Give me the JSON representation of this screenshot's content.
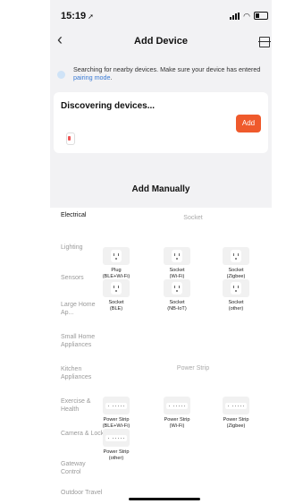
{
  "status": {
    "time": "15:19"
  },
  "nav": {
    "title": "Add Device"
  },
  "searching": {
    "text": "Searching for nearby devices. Make sure your device has entered ",
    "link": "pairing mode",
    "end": "."
  },
  "discover": {
    "title": "Discovering devices...",
    "add_label": "Add"
  },
  "manual": {
    "title": "Add Manually"
  },
  "categories": [
    "Electrical",
    "Lighting",
    "Sensors",
    "Large Home Ap...",
    "Small Home Appliances",
    "Kitchen Appliances",
    "Exercise & Health",
    "Camera & Lock",
    "Gateway Control",
    "Outdoor Travel"
  ],
  "sections": {
    "socket": "Socket",
    "power_strip": "Power Strip"
  },
  "sockets": [
    {
      "name": "Plug",
      "sub": "(BLE+Wi-Fi)"
    },
    {
      "name": "Socket",
      "sub": "(Wi-Fi)"
    },
    {
      "name": "Socket",
      "sub": "(Zigbee)"
    },
    {
      "name": "Socket",
      "sub": "(BLE)"
    },
    {
      "name": "Socket",
      "sub": "(NB-IoT)"
    },
    {
      "name": "Socket",
      "sub": "(other)"
    }
  ],
  "strips": [
    {
      "name": "Power Strip",
      "sub": "(BLE+Wi-Fi)"
    },
    {
      "name": "Power Strip",
      "sub": "(Wi-Fi)"
    },
    {
      "name": "Power Strip",
      "sub": "(Zigbee)"
    },
    {
      "name": "Power Strip",
      "sub": "(other)"
    }
  ]
}
